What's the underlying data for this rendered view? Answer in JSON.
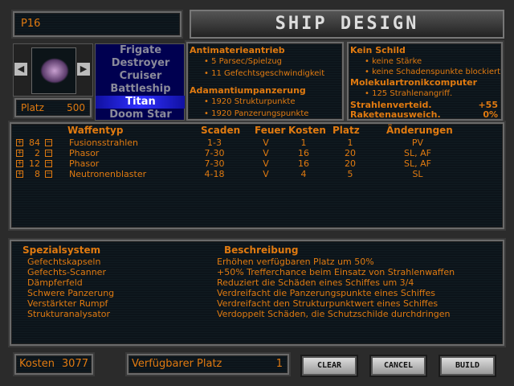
{
  "ship_name": "P16",
  "title": "SHIP DESIGN",
  "platz": {
    "label": "Platz",
    "value": "500"
  },
  "classes": [
    "Frigate",
    "Destroyer",
    "Cruiser",
    "Battleship",
    "Titan",
    "Doom Star"
  ],
  "selected_class": "Titan",
  "drive": {
    "name": "Antimaterieantrieb",
    "lines": [
      "5 Parsec/Spielzug",
      "11 Gefechtsgeschwindigkeit"
    ]
  },
  "armor": {
    "name": "Adamantiumpanzerung",
    "lines": [
      "1920 Strukturpunkte",
      "1920 Panzerungspunkte"
    ]
  },
  "shield": {
    "name": "Kein Schild",
    "lines": [
      "keine Stärke",
      "keine Schadenspunkte blockiert"
    ]
  },
  "computer": {
    "name": "Molekulartronikcomputer",
    "lines": [
      "125 Strahlenangriff."
    ]
  },
  "beam_defense": {
    "label": "Strahlenverteid.",
    "value": "+55"
  },
  "missile_evasion": {
    "label": "Raketenausweich.",
    "value": "0%"
  },
  "weapons": {
    "headers": [
      "Waffentyp",
      "Scaden",
      "Feuer",
      "Kosten",
      "Platz",
      "Änderungen"
    ],
    "rows": [
      {
        "count": "84",
        "name": "Fusionsstrahlen",
        "damage": "1-3",
        "fire": "V",
        "cost": "1",
        "space": "1",
        "mods": "PV"
      },
      {
        "count": "2",
        "name": "Phasor",
        "damage": "7-30",
        "fire": "V",
        "cost": "16",
        "space": "20",
        "mods": "SL, AF"
      },
      {
        "count": "12",
        "name": "Phasor",
        "damage": "7-30",
        "fire": "V",
        "cost": "16",
        "space": "20",
        "mods": "SL, AF"
      },
      {
        "count": "8",
        "name": "Neutronenblaster",
        "damage": "4-18",
        "fire": "V",
        "cost": "4",
        "space": "5",
        "mods": "SL"
      }
    ]
  },
  "specials": {
    "headers": [
      "Spezialsystem",
      "Beschreibung"
    ],
    "rows": [
      {
        "name": "Gefechtskapseln",
        "desc": "Erhöhen verfügbaren Platz um 50%"
      },
      {
        "name": "Gefechts-Scanner",
        "desc": "+50% Trefferchance beim Einsatz von Strahlenwaffen"
      },
      {
        "name": "Dämpferfeld",
        "desc": "Reduziert die Schäden eines Schiffes um 3/4"
      },
      {
        "name": "Schwere Panzerung",
        "desc": "Verdreifacht die Panzerungspunkte eines Schiffes"
      },
      {
        "name": "Verstärkter Rumpf",
        "desc": "Verdreifacht den Strukturpunktwert eines Schiffes"
      },
      {
        "name": "Strukturanalysator",
        "desc": "Verdoppelt Schäden, die Schutzschilde durchdringen"
      }
    ]
  },
  "footer": {
    "cost_label": "Kosten",
    "cost_value": "3077",
    "space_label": "Verfügbarer Platz",
    "space_value": "1",
    "clear": "CLEAR",
    "cancel": "CANCEL",
    "build": "BUILD"
  }
}
